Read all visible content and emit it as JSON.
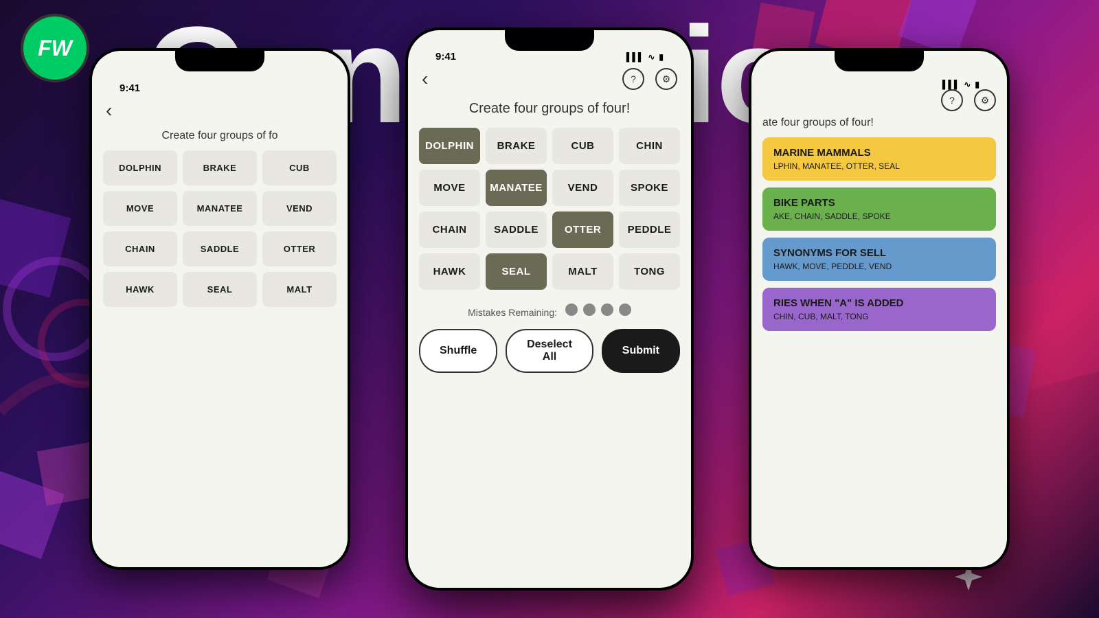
{
  "background": {
    "color": "#1a0a2e"
  },
  "fwLogo": {
    "text": "FW"
  },
  "connectionsTitle": "Connections",
  "centerPhone": {
    "statusBar": {
      "time": "9:41",
      "signal": "▌▌▌",
      "wifi": "WiFi",
      "battery": "🔋"
    },
    "gameTitle": "Create four groups of four!",
    "tiles": [
      {
        "word": "DOLPHIN",
        "selected": true
      },
      {
        "word": "BRAKE",
        "selected": false
      },
      {
        "word": "CUB",
        "selected": false
      },
      {
        "word": "CHIN",
        "selected": false
      },
      {
        "word": "MOVE",
        "selected": false
      },
      {
        "word": "MANATEE",
        "selected": true
      },
      {
        "word": "VEND",
        "selected": false
      },
      {
        "word": "SPOKE",
        "selected": false
      },
      {
        "word": "CHAIN",
        "selected": false
      },
      {
        "word": "SADDLE",
        "selected": false
      },
      {
        "word": "OTTER",
        "selected": true
      },
      {
        "word": "PEDDLE",
        "selected": false
      },
      {
        "word": "HAWK",
        "selected": false
      },
      {
        "word": "SEAL",
        "selected": true
      },
      {
        "word": "MALT",
        "selected": false
      },
      {
        "word": "TONG",
        "selected": false
      }
    ],
    "mistakesLabel": "Mistakes Remaining:",
    "dots": 4,
    "buttons": {
      "shuffle": "Shuffle",
      "deselectAll": "Deselect All",
      "submit": "Submit"
    }
  },
  "leftPhone": {
    "statusBar": {
      "time": "9:41"
    },
    "gameTitle": "Create four groups of fo",
    "tiles": [
      {
        "word": "DOLPHIN"
      },
      {
        "word": "BRAKE"
      },
      {
        "word": "CUB"
      },
      {
        "word": "MOVE"
      },
      {
        "word": "MANATEE"
      },
      {
        "word": "VEND"
      },
      {
        "word": "CHAIN"
      },
      {
        "word": "SADDLE"
      },
      {
        "word": "OTTER"
      },
      {
        "word": "HAWK"
      },
      {
        "word": "SEAL"
      },
      {
        "word": "MALT"
      }
    ]
  },
  "rightPhone": {
    "gameTitle": "ate four groups of four!",
    "categories": [
      {
        "color": "yellow",
        "title": "MARINE MAMMALS",
        "items": "LPHIN, MANATEE, OTTER, SEAL"
      },
      {
        "color": "green",
        "title": "BIKE PARTS",
        "items": "AKE, CHAIN, SADDLE, SPOKE"
      },
      {
        "color": "blue",
        "title": "SYNONYMS FOR SELL",
        "items": "HAWK, MOVE, PEDDLE, VEND"
      },
      {
        "color": "purple",
        "title": "RIES WHEN \"A\" IS ADDED",
        "items": "CHIN, CUB, MALT, TONG"
      }
    ]
  }
}
